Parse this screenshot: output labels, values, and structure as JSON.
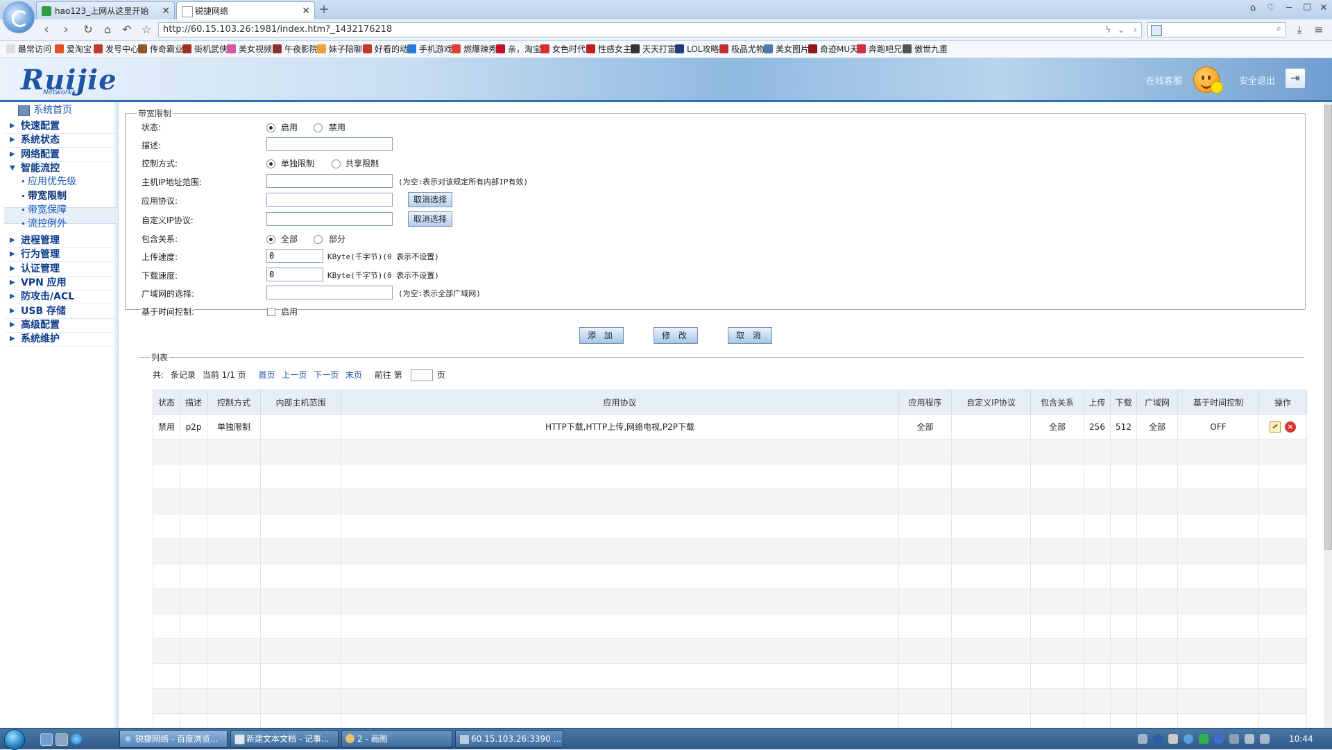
{
  "browser": {
    "tabs": [
      {
        "label": "hao123_上网从这里开始"
      },
      {
        "label": "锐捷网络"
      }
    ],
    "url": "http://60.15.103.26:1981/index.htm?_1432176218",
    "bookmarks": [
      "最常访问",
      "爱淘宝",
      "发号中心",
      "传奇霸业",
      "街机武侠",
      "美女视频",
      "午夜影院",
      "妹子陪聊",
      "好看的动",
      "手机游戏",
      "燃爆辣秀",
      "亲，淘宝",
      "女色时代",
      "性感女主",
      "天天打富",
      "LOL攻略",
      "极品尤物",
      "美女图片",
      "奇迹MU天",
      "奔跑吧兄",
      "傲世九重"
    ]
  },
  "header": {
    "logo": "Ruijie",
    "logo_sub": "Networks",
    "online_service": "在线客服",
    "safe_exit": "安全退出"
  },
  "sidebar": {
    "home": "系统首页",
    "items": [
      {
        "label": "快速配置",
        "type": "top"
      },
      {
        "label": "系统状态",
        "type": "top"
      },
      {
        "label": "网络配置",
        "type": "top"
      },
      {
        "label": "智能流控",
        "type": "top-open"
      },
      {
        "label": "应用优先级",
        "type": "sub"
      },
      {
        "label": "带宽限制",
        "type": "sub-active"
      },
      {
        "label": "带宽保障",
        "type": "sub"
      },
      {
        "label": "流控例外",
        "type": "sub"
      },
      {
        "label": "进程管理",
        "type": "top"
      },
      {
        "label": "行为管理",
        "type": "top"
      },
      {
        "label": "认证管理",
        "type": "top"
      },
      {
        "label": "VPN 应用",
        "type": "top"
      },
      {
        "label": "防攻击/ACL",
        "type": "top"
      },
      {
        "label": "USB 存储",
        "type": "top"
      },
      {
        "label": "高级配置",
        "type": "top"
      },
      {
        "label": "系统维护",
        "type": "top"
      }
    ]
  },
  "form": {
    "legend": "带宽限制",
    "status_label": "状态:",
    "status_on": "启用",
    "status_off": "禁用",
    "desc_label": "描述:",
    "control_label": "控制方式:",
    "control_single": "单独限制",
    "control_shared": "共享限制",
    "host_ip_label": "主机IP地址范围:",
    "host_ip_hint": "(为空:表示对该规定所有内部IP有效)",
    "app_proto_label": "应用协议:",
    "custom_ip_label": "自定义IP协议:",
    "deselect": "取消选择",
    "include_label": "包含关系:",
    "include_all": "全部",
    "include_part": "部分",
    "upload_label": "上传速度:",
    "upload_value": "0",
    "download_label": "下载速度:",
    "download_value": "0",
    "speed_hint": "KByte(千字节)(0 表示不设置)",
    "wan_label": "广域网的选择:",
    "wan_hint": "(为空:表示全部广域网)",
    "time_label": "基于时间控制:",
    "time_enable": "启用",
    "add": "添 加",
    "modify": "修 改",
    "cancel": "取 消"
  },
  "list": {
    "legend": "列表",
    "pager": {
      "total": "共:",
      "records": "条记录",
      "current": "当前 1/1 页",
      "first": "首页",
      "prev": "上一页",
      "next": "下一页",
      "last": "末页",
      "goto": "前往 第",
      "page": "页"
    },
    "columns": [
      "状态",
      "描述",
      "控制方式",
      "内部主机范围",
      "应用协议",
      "应用程序",
      "自定义IP协议",
      "包含关系",
      "上传",
      "下载",
      "广域网",
      "基于时间控制",
      "操作"
    ],
    "rows": [
      [
        "禁用",
        "p2p",
        "单独限制",
        "",
        "HTTP下载,HTTP上传,网络电视,P2P下载",
        "全部",
        "",
        "全部",
        "256",
        "512",
        "全部",
        "OFF",
        ""
      ]
    ]
  },
  "taskbar": {
    "tasks": [
      "锐捷网络 - 百度浏览...",
      "新建文本文档 - 记事...",
      "2 - 画图",
      "60.15.103.26:3390 ..."
    ],
    "clock": "10:44"
  }
}
